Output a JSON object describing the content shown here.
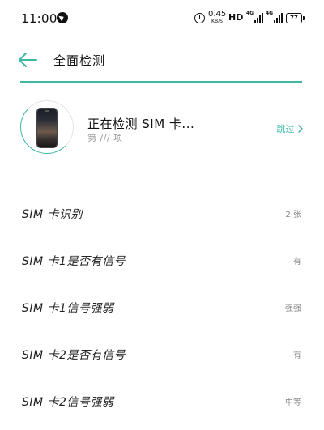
{
  "status_bar": {
    "time": "11:00",
    "net_speed_value": "0.45",
    "net_speed_unit": "KB/S",
    "hd_label": "HD",
    "sim1_gen": "4G",
    "sim2_gen": "4G",
    "battery_level": "77"
  },
  "header": {
    "title": "全面检测"
  },
  "progress": {
    "fraction": 1.0
  },
  "current_test": {
    "title": "正在检测 SIM 卡...",
    "subtitle": "第 /// 项",
    "skip_label": "跳过"
  },
  "results": [
    {
      "label": "SIM 卡识别",
      "value": "2 张"
    },
    {
      "label": "SIM 卡1是否有信号",
      "value": "有"
    },
    {
      "label": "SIM 卡1信号强弱",
      "value": "强强"
    },
    {
      "label": "SIM 卡2是否有信号",
      "value": "有"
    },
    {
      "label": "SIM 卡2信号强弱",
      "value": "中等"
    }
  ],
  "colors": {
    "accent": "#3cb8a4",
    "text": "#222222",
    "muted": "#888888"
  }
}
